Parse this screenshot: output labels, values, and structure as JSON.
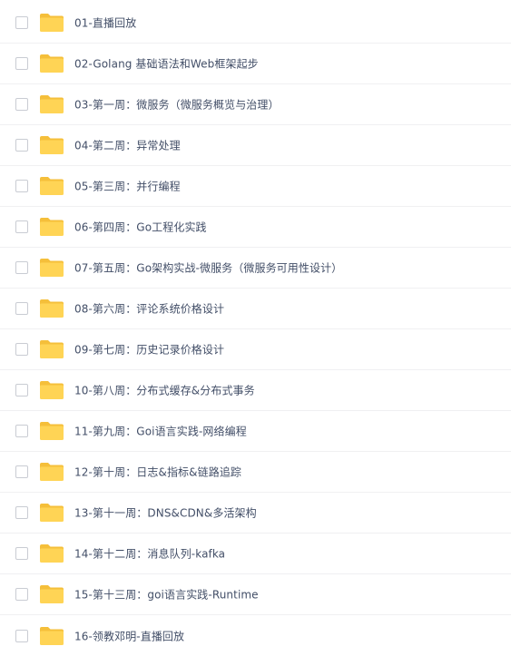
{
  "files": [
    {
      "name": "01-直播回放",
      "icon": "folder-icon"
    },
    {
      "name": "02-Golang 基础语法和Web框架起步",
      "icon": "folder-icon"
    },
    {
      "name": "03-第一周：微服务（微服务概览与治理）",
      "icon": "folder-icon"
    },
    {
      "name": "04-第二周：异常处理",
      "icon": "folder-icon"
    },
    {
      "name": "05-第三周：并行编程",
      "icon": "folder-icon"
    },
    {
      "name": "06-第四周：Go工程化实践",
      "icon": "folder-icon"
    },
    {
      "name": "07-第五周：Go架构实战-微服务（微服务可用性设计）",
      "icon": "folder-icon"
    },
    {
      "name": "08-第六周：评论系统价格设计",
      "icon": "folder-icon"
    },
    {
      "name": "09-第七周：历史记录价格设计",
      "icon": "folder-icon"
    },
    {
      "name": "10-第八周：分布式缓存&分布式事务",
      "icon": "folder-icon"
    },
    {
      "name": "11-第九周：Goi语言实践-网络编程",
      "icon": "folder-icon"
    },
    {
      "name": "12-第十周：日志&指标&链路追踪",
      "icon": "folder-icon"
    },
    {
      "name": "13-第十一周：DNS&CDN&多活架构",
      "icon": "folder-icon"
    },
    {
      "name": "14-第十二周：消息队列-kafka",
      "icon": "folder-icon"
    },
    {
      "name": "15-第十三周：goi语言实践-Runtime",
      "icon": "folder-icon"
    },
    {
      "name": "16-领教邓明-直播回放",
      "icon": "folder-icon"
    }
  ],
  "colors": {
    "folder_body": "#ffd455",
    "folder_tab": "#f5bf3a",
    "text": "#424e67",
    "divider": "#f0f0f2",
    "checkbox_border": "#c9ccd3"
  }
}
